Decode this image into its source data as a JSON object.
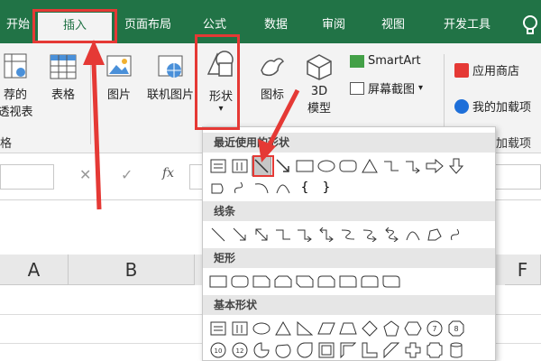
{
  "tabs": [
    "开始",
    "插入",
    "页面布局",
    "公式",
    "数据",
    "审阅",
    "视图",
    "开发工具"
  ],
  "help_icon": "lightbulb-icon",
  "ribbon": {
    "pivot_label_line1": "荐的",
    "pivot_label_line2": "透视表",
    "table_label": "表格",
    "group_tables": "格",
    "picture_label": "图片",
    "online_picture_label": "联机图片",
    "shapes_label": "形状",
    "icons_label": "图标",
    "model3d_line1": "3D",
    "model3d_line2": "模型",
    "smartart_label": "SmartArt",
    "screenshot_label": "屏幕截图",
    "app_store_label": "应用商店",
    "my_addins_label": "我的加载项",
    "group_addins": "加载项"
  },
  "formula_bar": {
    "fx_label": "fx"
  },
  "columns": [
    "A",
    "B",
    "F"
  ],
  "dropdown": {
    "sections": [
      "最近使用的形状",
      "线条",
      "矩形",
      "基本形状"
    ]
  }
}
